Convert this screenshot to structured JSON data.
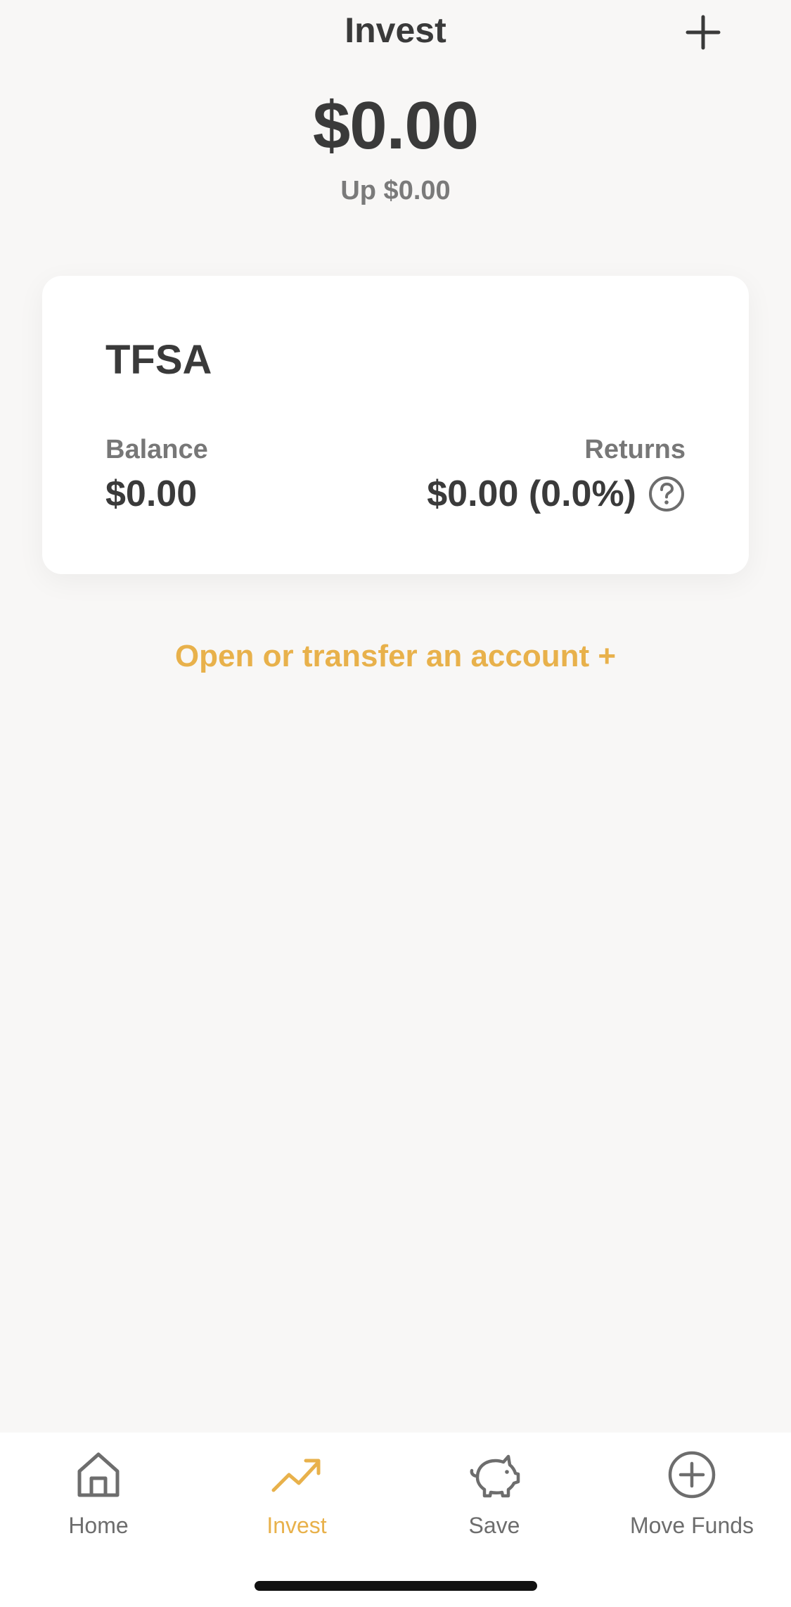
{
  "header": {
    "title": "Invest",
    "add_icon": "plus-icon"
  },
  "summary": {
    "total": "$0.00",
    "change": "Up $0.00"
  },
  "account_card": {
    "name": "TFSA",
    "balance_label": "Balance",
    "balance_value": "$0.00",
    "returns_label": "Returns",
    "returns_value": "$0.00 (0.0%)",
    "help_icon": "question-circle-icon"
  },
  "open_account_link": "Open or transfer an account +",
  "tabbar": {
    "active": "Invest",
    "items": [
      {
        "label": "Home",
        "icon": "home-icon"
      },
      {
        "label": "Invest",
        "icon": "trending-up-icon"
      },
      {
        "label": "Save",
        "icon": "piggy-bank-icon"
      },
      {
        "label": "Move Funds",
        "icon": "plus-circle-icon"
      }
    ]
  },
  "colors": {
    "background": "#f8f7f6",
    "accent": "#e8b14b",
    "text_primary": "#3a3a3a",
    "text_secondary": "#777777"
  }
}
